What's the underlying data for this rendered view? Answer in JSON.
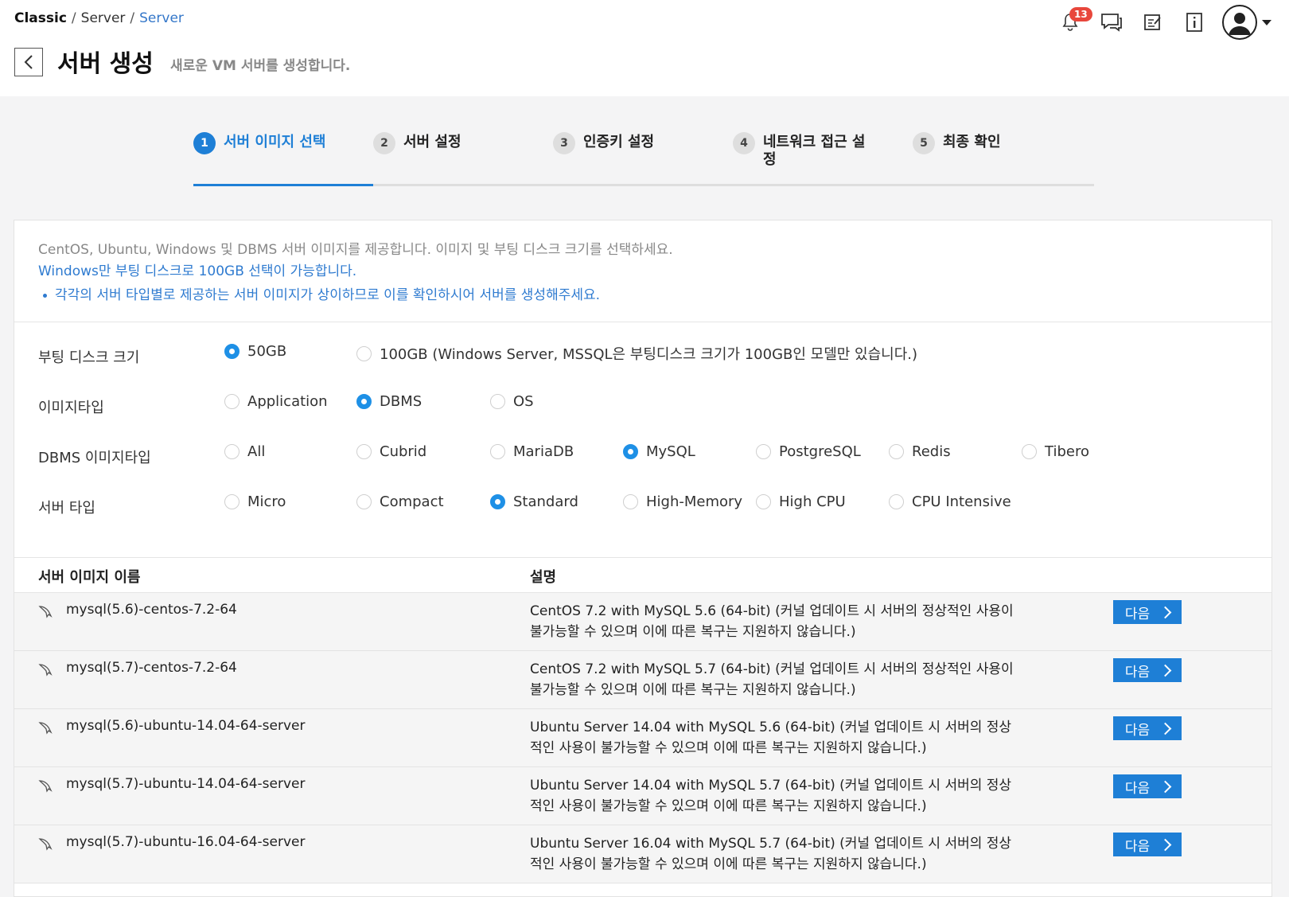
{
  "breadcrumb": {
    "root": "Classic",
    "sep1": "/",
    "section": "Server",
    "sep2": "/",
    "current": "Server"
  },
  "header": {
    "notification_count": "13"
  },
  "page": {
    "title": "서버 생성",
    "subtitle": "새로운 VM 서버를 생성합니다."
  },
  "steps": [
    {
      "num": "1",
      "label": "서버 이미지 선택"
    },
    {
      "num": "2",
      "label": "서버 설정"
    },
    {
      "num": "3",
      "label": "인증키 설정"
    },
    {
      "num": "4",
      "label": "네트워크 접근 설정"
    },
    {
      "num": "5",
      "label": "최종 확인"
    }
  ],
  "intro": {
    "line1": "CentOS, Ubuntu, Windows 및 DBMS 서버 이미지를 제공합니다. 이미지 및 부팅 디스크 크기를 선택하세요.",
    "line2": "Windows만 부팅 디스크로 100GB 선택이 가능합니다.",
    "bullet": "각각의 서버 타입별로 제공하는 서버 이미지가 상이하므로 이를 확인하시어 서버를 생성해주세요."
  },
  "options": {
    "boot_disk": {
      "label": "부팅 디스크 크기",
      "choices": [
        "50GB",
        "100GB (Windows Server, MSSQL은 부팅디스크 크기가 100GB인 모델만 있습니다.)"
      ],
      "selected": "50GB"
    },
    "image_type": {
      "label": "이미지타입",
      "choices": [
        "Application",
        "DBMS",
        "OS"
      ],
      "selected": "DBMS"
    },
    "dbms_type": {
      "label": "DBMS 이미지타입",
      "choices": [
        "All",
        "Cubrid",
        "MariaDB",
        "MySQL",
        "PostgreSQL",
        "Redis",
        "Tibero"
      ],
      "selected": "MySQL"
    },
    "server_type": {
      "label": "서버 타입",
      "choices": [
        "Micro",
        "Compact",
        "Standard",
        "High-Memory",
        "High CPU",
        "CPU Intensive"
      ],
      "selected": "Standard"
    }
  },
  "table": {
    "col_name": "서버 이미지 이름",
    "col_desc": "설명",
    "next_label": "다음",
    "rows": [
      {
        "name": "mysql(5.6)-centos-7.2-64",
        "desc": "CentOS 7.2 with MySQL 5.6 (64-bit) (커널 업데이트 시 서버의 정상적인 사용이 불가능할 수 있으며 이에 따른 복구는 지원하지 않습니다.)"
      },
      {
        "name": "mysql(5.7)-centos-7.2-64",
        "desc": "CentOS 7.2 with MySQL 5.7 (64-bit) (커널 업데이트 시 서버의 정상적인 사용이 불가능할 수 있으며 이에 따른 복구는 지원하지 않습니다.)"
      },
      {
        "name": "mysql(5.6)-ubuntu-14.04-64-server",
        "desc": "Ubuntu Server 14.04 with MySQL 5.6 (64-bit) (커널 업데이트 시 서버의 정상적인 사용이 불가능할 수 있으며 이에 따른 복구는 지원하지 않습니다.)"
      },
      {
        "name": "mysql(5.7)-ubuntu-14.04-64-server",
        "desc": "Ubuntu Server 14.04 with MySQL 5.7 (64-bit) (커널 업데이트 시 서버의 정상적인 사용이 불가능할 수 있으며 이에 따른 복구는 지원하지 않습니다.)"
      },
      {
        "name": "mysql(5.7)-ubuntu-16.04-64-server",
        "desc": "Ubuntu Server 16.04 with MySQL 5.7 (64-bit) (커널 업데이트 시 서버의 정상적인 사용이 불가능할 수 있으며 이에 따른 복구는 지원하지 않습니다.)"
      }
    ]
  },
  "icons": [
    "bell-icon",
    "chat-icon",
    "memo-icon",
    "info-icon",
    "user-avatar-icon",
    "back-arrow-icon",
    "dolphin-icon",
    "chevron-right-icon"
  ],
  "colors": {
    "primary": "#1e7fd6",
    "radio_on": "#1e90e6",
    "badge": "#e8473c",
    "link": "#2f7bd0"
  }
}
